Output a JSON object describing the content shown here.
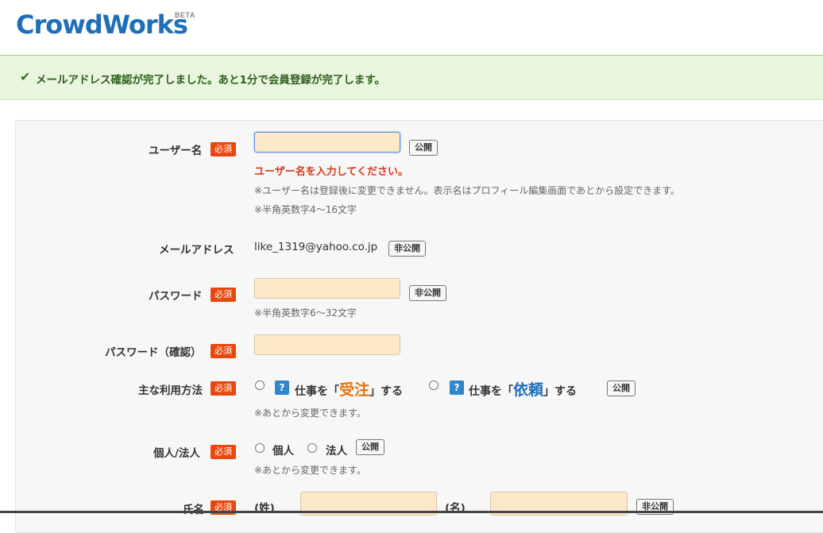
{
  "brand": {
    "name": "CrowdWorks",
    "beta": "BETA"
  },
  "notice": {
    "icon": "checkmark-icon",
    "text": "メールアドレス確認が完了しました。あと1分で会員登録が完了します。"
  },
  "required_label": "必須",
  "form": {
    "username": {
      "label": "ユーザー名",
      "value": "",
      "visibility": "公開",
      "error": "ユーザー名を入力してください。",
      "note1": "※ユーザー名は登録後に変更できません。表示名はプロフィール編集画面であとから設定できます。",
      "note2": "※半角英数字4〜16文字"
    },
    "email": {
      "label": "メールアドレス",
      "value": "like_1319@yahoo.co.jp",
      "visibility": "非公開"
    },
    "password": {
      "label": "パスワード",
      "value": "",
      "visibility": "非公開",
      "note": "※半角英数字6〜32文字"
    },
    "password_confirm": {
      "label": "パスワード（確認）",
      "value": ""
    },
    "usage": {
      "label": "主な利用方法",
      "option1": {
        "prefix": "仕事を「",
        "highlight": "受注",
        "suffix": "」する"
      },
      "option2": {
        "prefix": "仕事を「",
        "highlight": "依頼",
        "suffix": "」する"
      },
      "visibility": "公開",
      "note": "※あとから変更できます。"
    },
    "entity": {
      "label": "個人/法人",
      "option1": "個人",
      "option2": "法人",
      "visibility": "公開",
      "note": "※あとから変更できます。"
    },
    "name": {
      "label": "氏名",
      "last_label": "(姓)",
      "first_label": "(名)",
      "visibility": "非公開"
    }
  }
}
